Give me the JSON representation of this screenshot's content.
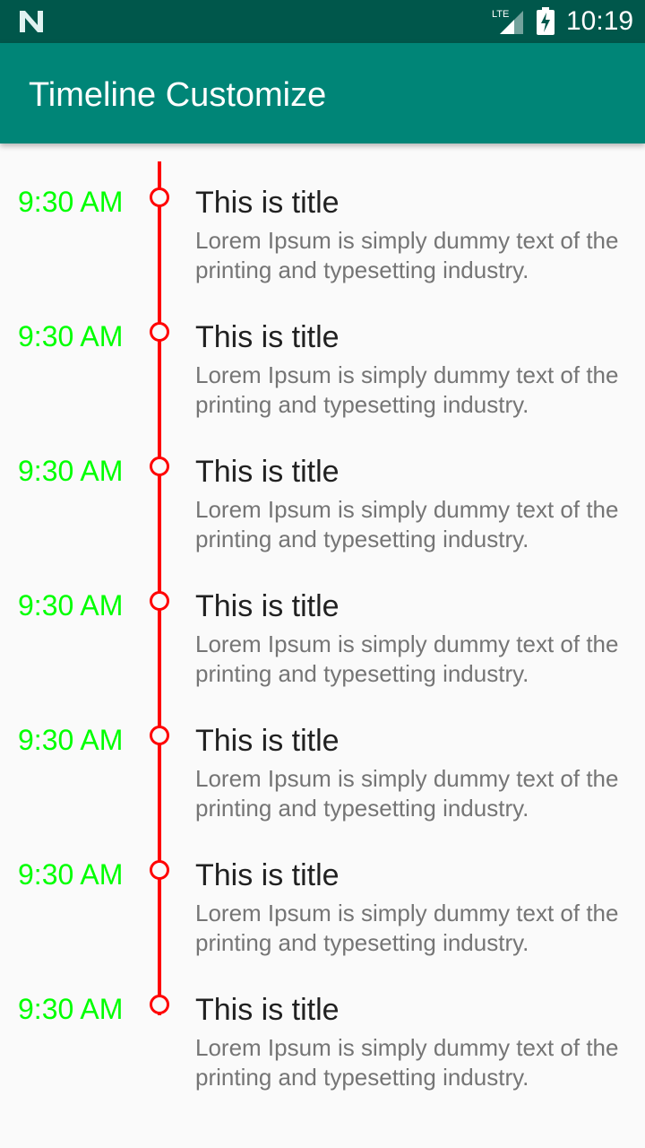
{
  "status_bar": {
    "time": "10:19",
    "network_label": "LTE",
    "icons": [
      "notification-n-icon",
      "lte-signal-icon",
      "battery-charging-icon"
    ]
  },
  "app_bar": {
    "title": "Timeline Customize",
    "color": "#008577"
  },
  "colors": {
    "status_bar": "#00574b",
    "time_text": "#00ff00",
    "timeline_line": "#ff0000",
    "title_text": "#212121",
    "description_text": "#757575",
    "background": "#fafafa"
  },
  "timeline": {
    "items": [
      {
        "time": "9:30 AM",
        "title": "This is title",
        "description": "Lorem Ipsum is simply dummy text of the printing and typesetting industry."
      },
      {
        "time": "9:30 AM",
        "title": "This is title",
        "description": "Lorem Ipsum is simply dummy text of the printing and typesetting industry."
      },
      {
        "time": "9:30 AM",
        "title": "This is title",
        "description": "Lorem Ipsum is simply dummy text of the printing and typesetting industry."
      },
      {
        "time": "9:30 AM",
        "title": "This is title",
        "description": "Lorem Ipsum is simply dummy text of the printing and typesetting industry."
      },
      {
        "time": "9:30 AM",
        "title": "This is title",
        "description": "Lorem Ipsum is simply dummy text of the printing and typesetting industry."
      },
      {
        "time": "9:30 AM",
        "title": "This is title",
        "description": "Lorem Ipsum is simply dummy text of the printing and typesetting industry."
      },
      {
        "time": "9:30 AM",
        "title": "This is title",
        "description": "Lorem Ipsum is simply dummy text of the printing and typesetting industry."
      }
    ]
  }
}
